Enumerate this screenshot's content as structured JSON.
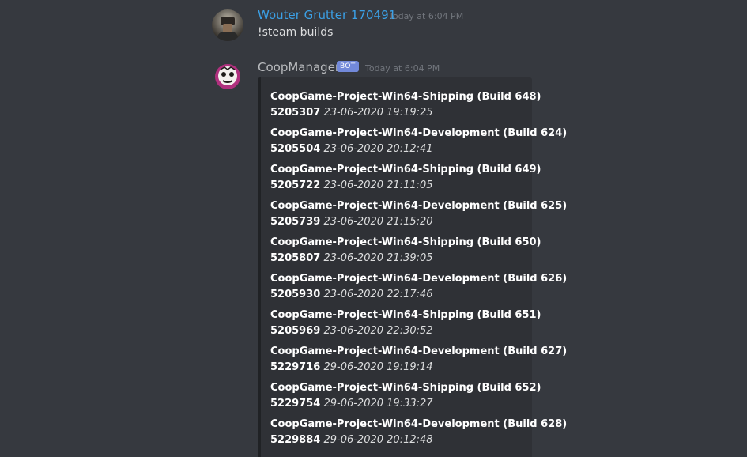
{
  "messages": [
    {
      "author": "Wouter Grutter 170491",
      "timestamp": "Today at 6:04 PM",
      "text": "!steam builds"
    },
    {
      "author": "CoopManager",
      "badge": "BOT",
      "timestamp": "Today at 6:04 PM"
    }
  ],
  "builds": [
    {
      "name": "CoopGame-Project-Win64-Shipping (Build 648)",
      "id": "5205307",
      "time": "23-06-2020 19:19:25"
    },
    {
      "name": "CoopGame-Project-Win64-Development (Build 624)",
      "id": "5205504",
      "time": "23-06-2020 20:12:41"
    },
    {
      "name": "CoopGame-Project-Win64-Shipping (Build 649)",
      "id": "5205722",
      "time": "23-06-2020 21:11:05"
    },
    {
      "name": "CoopGame-Project-Win64-Development (Build 625)",
      "id": "5205739",
      "time": "23-06-2020 21:15:20"
    },
    {
      "name": "CoopGame-Project-Win64-Shipping (Build 650)",
      "id": "5205807",
      "time": "23-06-2020 21:39:05"
    },
    {
      "name": "CoopGame-Project-Win64-Development (Build 626)",
      "id": "5205930",
      "time": "23-06-2020 22:17:46"
    },
    {
      "name": "CoopGame-Project-Win64-Shipping (Build 651)",
      "id": "5205969",
      "time": "23-06-2020 22:30:52"
    },
    {
      "name": "CoopGame-Project-Win64-Development (Build 627)",
      "id": "5229716",
      "time": "29-06-2020 19:19:14"
    },
    {
      "name": "CoopGame-Project-Win64-Shipping (Build 652)",
      "id": "5229754",
      "time": "29-06-2020 19:33:27"
    },
    {
      "name": "CoopGame-Project-Win64-Development (Build 628)",
      "id": "5229884",
      "time": "29-06-2020 20:12:48"
    }
  ],
  "colors": {
    "background": "#36393f",
    "embed_background": "#2f3136",
    "user_name": "#3ba0e6",
    "bot_name": "#b9bbbe",
    "bot_badge": "#7289da",
    "timestamp": "#72767d"
  },
  "icons": {
    "user_avatar": "user-avatar-image",
    "bot_avatar": "bot-avatar-image"
  }
}
